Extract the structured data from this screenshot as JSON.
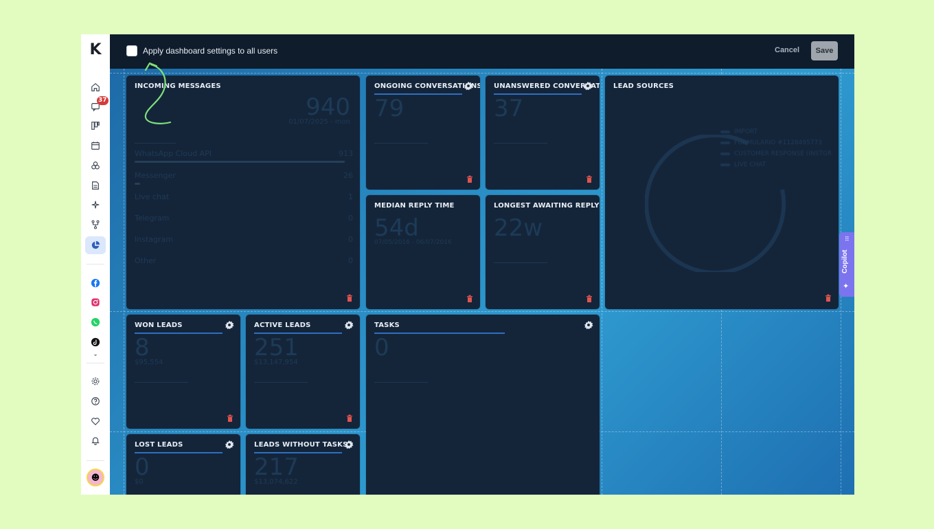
{
  "topbar": {
    "apply_label": "Apply dashboard settings to all users",
    "cancel_label": "Cancel",
    "save_label": "Save"
  },
  "sidebar": {
    "logo": "K",
    "chat_badge": "37",
    "items": [
      "home-icon",
      "chat-icon",
      "kanban-icon",
      "calendar-icon",
      "contacts-icon",
      "document-icon",
      "sparkle-icon",
      "flow-icon",
      "chart-pie-icon",
      "facebook-icon",
      "instagram-icon",
      "whatsapp-icon",
      "tiktok-icon",
      "settings-icon",
      "help-icon",
      "heart-icon",
      "bell-icon"
    ],
    "active": "chart-pie-icon"
  },
  "widgets": {
    "incoming": {
      "title": "INCOMING MESSAGES",
      "value": "940",
      "date": "01/07/2025 - mon",
      "channels": [
        {
          "name": "WhatsApp Cloud API",
          "value": "913"
        },
        {
          "name": "Messenger",
          "value": "26"
        },
        {
          "name": "Live chat",
          "value": "1"
        },
        {
          "name": "Telegram",
          "value": "0"
        },
        {
          "name": "Instagram",
          "value": "0"
        },
        {
          "name": "Other",
          "value": "0"
        }
      ]
    },
    "ongoing": {
      "title": "ONGOING CONVERSATIONS",
      "value": "79"
    },
    "unanswered": {
      "title": "UNANSWERED CONVERSATI",
      "value": "37"
    },
    "lead_sources": {
      "title": "LEAD SOURCES",
      "legend": [
        "IMPORT",
        "FORMULARIO #1128495773",
        "CUSTOMER RESPONSE (INSTGR",
        "LIVE CHAT"
      ]
    },
    "median_reply": {
      "title": "MEDIAN REPLY TIME",
      "value": "54d",
      "date": "07/05/2016 - 06/07/2016"
    },
    "longest_awaiting": {
      "title": "LONGEST AWAITING REPLY",
      "value": "22w"
    },
    "won": {
      "title": "WON LEADS",
      "value": "8",
      "sub": "$95,554"
    },
    "active": {
      "title": "ACTIVE LEADS",
      "value": "251",
      "sub": "$13,147,954"
    },
    "tasks": {
      "title": "TASKS",
      "value": "0"
    },
    "lost": {
      "title": "LOST LEADS",
      "value": "0",
      "sub": "$0"
    },
    "without_tasks": {
      "title": "LEADS WITHOUT TASKS",
      "value": "217",
      "sub": "$13,074,622"
    }
  },
  "copilot": {
    "label": "Copilot"
  },
  "colors": {
    "accent": "#2f6fc0",
    "trash": "#e0544f",
    "copilot": "#7b74ee",
    "panel": "#14253a",
    "topbar": "#0f1c2b"
  }
}
